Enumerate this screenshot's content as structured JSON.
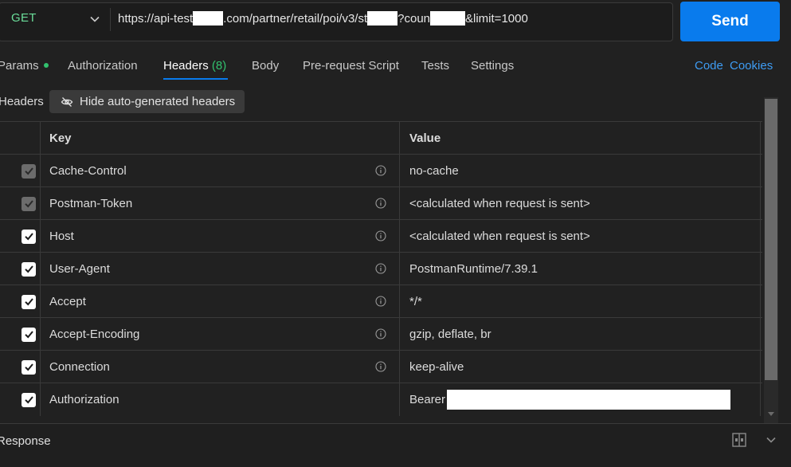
{
  "request": {
    "method": "GET",
    "url_parts": [
      "https://api-test",
      ".com/partner/retail/poi/v3/st",
      "?coun",
      "&limit=1000"
    ],
    "send_label": "Send"
  },
  "tabs": {
    "params": "Params",
    "authorization": "Authorization",
    "headers": "Headers",
    "headers_count": "(8)",
    "body": "Body",
    "prerequest": "Pre-request Script",
    "tests": "Tests",
    "settings": "Settings",
    "code": "Code",
    "cookies": "Cookies"
  },
  "headers_section": {
    "label": "Headers",
    "hide_button": "Hide auto-generated headers"
  },
  "table": {
    "key_header": "Key",
    "value_header": "Value",
    "rows": [
      {
        "key": "Cache-Control",
        "value": "no-cache",
        "checked": true,
        "disabled": true,
        "info": true
      },
      {
        "key": "Postman-Token",
        "value": "<calculated when request is sent>",
        "checked": true,
        "disabled": true,
        "info": true
      },
      {
        "key": "Host",
        "value": "<calculated when request is sent>",
        "checked": true,
        "disabled": false,
        "info": true
      },
      {
        "key": "User-Agent",
        "value": "PostmanRuntime/7.39.1",
        "checked": true,
        "disabled": false,
        "info": true
      },
      {
        "key": "Accept",
        "value": "*/*",
        "checked": true,
        "disabled": false,
        "info": true
      },
      {
        "key": "Accept-Encoding",
        "value": "gzip, deflate, br",
        "checked": true,
        "disabled": false,
        "info": true
      },
      {
        "key": "Connection",
        "value": "keep-alive",
        "checked": true,
        "disabled": false,
        "info": true
      },
      {
        "key": "Authorization",
        "value": "Bearer",
        "checked": true,
        "disabled": false,
        "info": false
      }
    ]
  },
  "response": {
    "label": "Response"
  },
  "colors": {
    "accent": "#097bed",
    "method_get": "#6bdd9a",
    "active_count": "#32c16e",
    "link": "#3e9cf3"
  }
}
